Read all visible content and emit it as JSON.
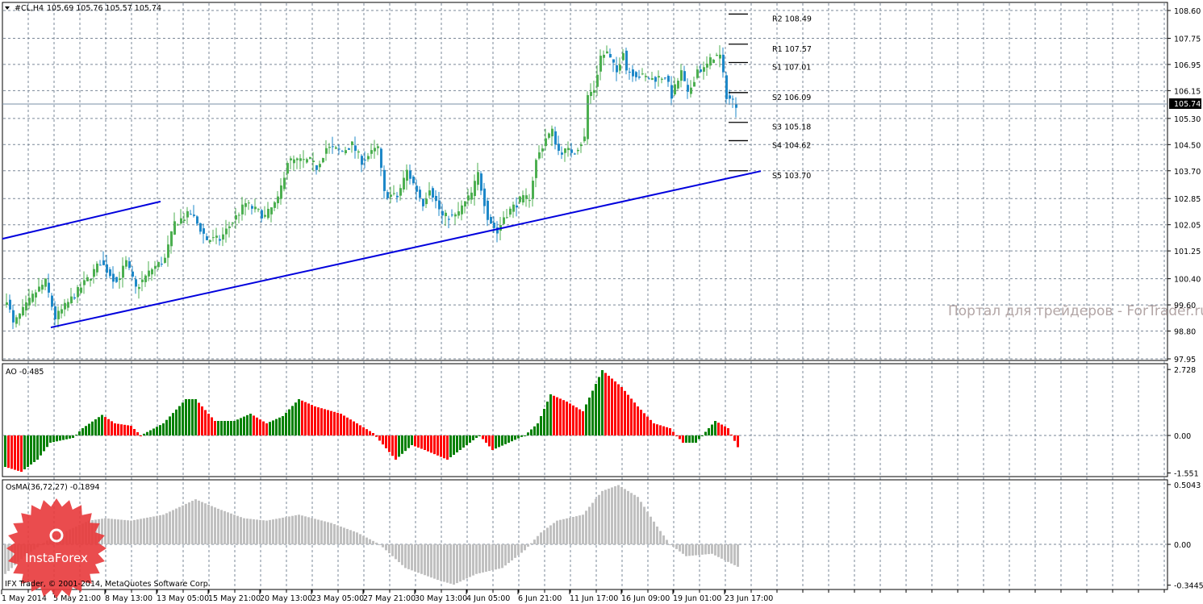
{
  "header": {
    "arrow_icon": "triangle-down-icon",
    "symbol": "#CL,H4",
    "ohlc": "105.69 105.76 105.57 105.74"
  },
  "copyright": "IFX Trader, © 2001-2014, MetaQuotes Software Corp.",
  "watermark": "Портал для трейдеров - ForTrader.ru",
  "logo": {
    "text": "InstaForex",
    "color": "#e8393b"
  },
  "colors": {
    "bull": "#4caf50",
    "bear": "#1e88c8",
    "trend": "#0000dd",
    "ao_up": "#008000",
    "ao_down": "#ff0000",
    "osma": "#c0c0c0"
  },
  "chart_data": [
    {
      "type": "candlestick",
      "title": "#CL,H4",
      "ylim": [
        97.95,
        108.6
      ],
      "yticks": [
        "108.60",
        "107.75",
        "106.95",
        "106.15",
        "105.30",
        "104.50",
        "103.70",
        "102.85",
        "102.05",
        "101.25",
        "100.40",
        "99.60",
        "98.80",
        "97.95"
      ],
      "current_price": "105.74",
      "price_path": [
        [
          0,
          99.8
        ],
        [
          2,
          99.0
        ],
        [
          9,
          100.0
        ],
        [
          12,
          100.3
        ],
        [
          15,
          99.2
        ],
        [
          21,
          99.9
        ],
        [
          26,
          100.5
        ],
        [
          29,
          100.9
        ],
        [
          34,
          100.3
        ],
        [
          37,
          100.9
        ],
        [
          40,
          100.1
        ],
        [
          45,
          100.7
        ],
        [
          49,
          101.0
        ],
        [
          52,
          102.1
        ],
        [
          57,
          102.4
        ],
        [
          62,
          101.6
        ],
        [
          66,
          101.6
        ],
        [
          74,
          102.7
        ],
        [
          80,
          102.3
        ],
        [
          84,
          102.8
        ],
        [
          87,
          104.0
        ],
        [
          94,
          104.0
        ],
        [
          96,
          103.8
        ],
        [
          99,
          104.4
        ],
        [
          104,
          104.3
        ],
        [
          107,
          104.5
        ],
        [
          110,
          104.0
        ],
        [
          115,
          104.4
        ],
        [
          117,
          103.0
        ],
        [
          121,
          102.9
        ],
        [
          124,
          103.7
        ],
        [
          129,
          102.7
        ],
        [
          131,
          103.2
        ],
        [
          135,
          102.3
        ],
        [
          139,
          102.3
        ],
        [
          144,
          103.0
        ],
        [
          146,
          103.6
        ],
        [
          149,
          102.3
        ],
        [
          152,
          101.8
        ],
        [
          154,
          102.3
        ],
        [
          159,
          102.8
        ],
        [
          162,
          102.9
        ],
        [
          164,
          104.0
        ],
        [
          167,
          104.7
        ],
        [
          169,
          104.9
        ],
        [
          171,
          104.3
        ],
        [
          176,
          104.3
        ],
        [
          179,
          104.7
        ],
        [
          180,
          106.0
        ],
        [
          182,
          106.2
        ],
        [
          184,
          107.2
        ],
        [
          186,
          107.3
        ],
        [
          189,
          106.7
        ],
        [
          191,
          107.4
        ],
        [
          192,
          106.8
        ],
        [
          196,
          106.6
        ],
        [
          200,
          106.5
        ],
        [
          204,
          106.6
        ],
        [
          206,
          106.0
        ],
        [
          209,
          106.7
        ],
        [
          211,
          106.0
        ],
        [
          214,
          106.8
        ],
        [
          216,
          106.8
        ],
        [
          219,
          107.2
        ],
        [
          221,
          107.2
        ],
        [
          223,
          106.0
        ],
        [
          224,
          105.9
        ],
        [
          226,
          105.74
        ]
      ],
      "trendlines": [
        {
          "name": "upper-channel-line",
          "from": [
            0,
            101.62
          ],
          "to": [
            48,
            102.76
          ]
        },
        {
          "name": "lower-trendline",
          "from": [
            15,
            98.91
          ],
          "to": [
            234,
            103.69
          ]
        }
      ],
      "pivots": [
        {
          "label": "R2 108.49",
          "value": 108.49
        },
        {
          "label": "R1 107.57",
          "value": 107.57
        },
        {
          "label": "S1 107.01",
          "value": 107.01
        },
        {
          "label": "S2 106.09",
          "value": 106.09
        },
        {
          "label": "S3 105.18",
          "value": 105.18
        },
        {
          "label": "S4 104.62",
          "value": 104.62
        },
        {
          "label": "S5 103.70",
          "value": 103.7
        }
      ],
      "xticks": [
        "1 May 2014",
        "5 May 21:00",
        "8 May 13:00",
        "13 May 05:00",
        "15 May 21:00",
        "20 May 13:00",
        "23 May 05:00",
        "27 May 21:00",
        "30 May 13:00",
        "4 Jun 05:00",
        "6 Jun 21:00",
        "11 Jun 17:00",
        "16 Jun 09:00",
        "19 Jun 01:00",
        "23 Jun 17:00"
      ]
    },
    {
      "type": "bar",
      "title": "AO -0.485",
      "ylim": [
        -1.551,
        2.728
      ],
      "yticks": [
        "2.728",
        "0.00",
        "-1.551"
      ],
      "path": [
        [
          0,
          -1.3
        ],
        [
          5,
          -1.5
        ],
        [
          10,
          -1.0
        ],
        [
          14,
          -0.3
        ],
        [
          21,
          -0.1
        ],
        [
          24,
          0.3
        ],
        [
          30,
          0.85
        ],
        [
          34,
          0.5
        ],
        [
          39,
          0.4
        ],
        [
          42,
          0.0
        ],
        [
          49,
          0.5
        ],
        [
          56,
          1.5
        ],
        [
          59,
          1.5
        ],
        [
          65,
          0.6
        ],
        [
          71,
          0.6
        ],
        [
          76,
          0.9
        ],
        [
          81,
          0.5
        ],
        [
          86,
          0.8
        ],
        [
          91,
          1.5
        ],
        [
          96,
          1.2
        ],
        [
          104,
          0.9
        ],
        [
          114,
          0.1
        ],
        [
          121,
          -1.0
        ],
        [
          126,
          -0.4
        ],
        [
          130,
          -0.6
        ],
        [
          137,
          -1.0
        ],
        [
          142,
          -0.5
        ],
        [
          147,
          0.0
        ],
        [
          151,
          -0.6
        ],
        [
          156,
          -0.3
        ],
        [
          161,
          0.0
        ],
        [
          165,
          0.5
        ],
        [
          169,
          1.7
        ],
        [
          174,
          1.4
        ],
        [
          179,
          1.0
        ],
        [
          185,
          2.7
        ],
        [
          191,
          2.0
        ],
        [
          196,
          1.2
        ],
        [
          201,
          0.5
        ],
        [
          206,
          0.3
        ],
        [
          210,
          -0.3
        ],
        [
          214,
          -0.3
        ],
        [
          220,
          0.6
        ],
        [
          224,
          0.3
        ],
        [
          227,
          -0.485
        ]
      ]
    },
    {
      "type": "bar",
      "title": "OsMA(36,72,27) -0.1894",
      "ylim": [
        -0.3445,
        0.5043
      ],
      "yticks": [
        "0.5043",
        "0.00",
        "-0.3445"
      ],
      "path": [
        [
          0,
          -0.25
        ],
        [
          6,
          -0.1
        ],
        [
          14,
          0.05
        ],
        [
          26,
          0.2
        ],
        [
          31,
          0.22
        ],
        [
          39,
          0.2
        ],
        [
          49,
          0.25
        ],
        [
          59,
          0.38
        ],
        [
          66,
          0.3
        ],
        [
          74,
          0.22
        ],
        [
          81,
          0.2
        ],
        [
          91,
          0.25
        ],
        [
          101,
          0.18
        ],
        [
          109,
          0.1
        ],
        [
          116,
          0.0
        ],
        [
          124,
          -0.2
        ],
        [
          134,
          -0.3
        ],
        [
          139,
          -0.34
        ],
        [
          146,
          -0.25
        ],
        [
          154,
          -0.2
        ],
        [
          161,
          -0.05
        ],
        [
          166,
          0.1
        ],
        [
          171,
          0.2
        ],
        [
          179,
          0.25
        ],
        [
          185,
          0.45
        ],
        [
          190,
          0.5
        ],
        [
          196,
          0.4
        ],
        [
          202,
          0.15
        ],
        [
          206,
          0.0
        ],
        [
          211,
          -0.1
        ],
        [
          219,
          -0.08
        ],
        [
          227,
          -0.1894
        ]
      ]
    }
  ]
}
